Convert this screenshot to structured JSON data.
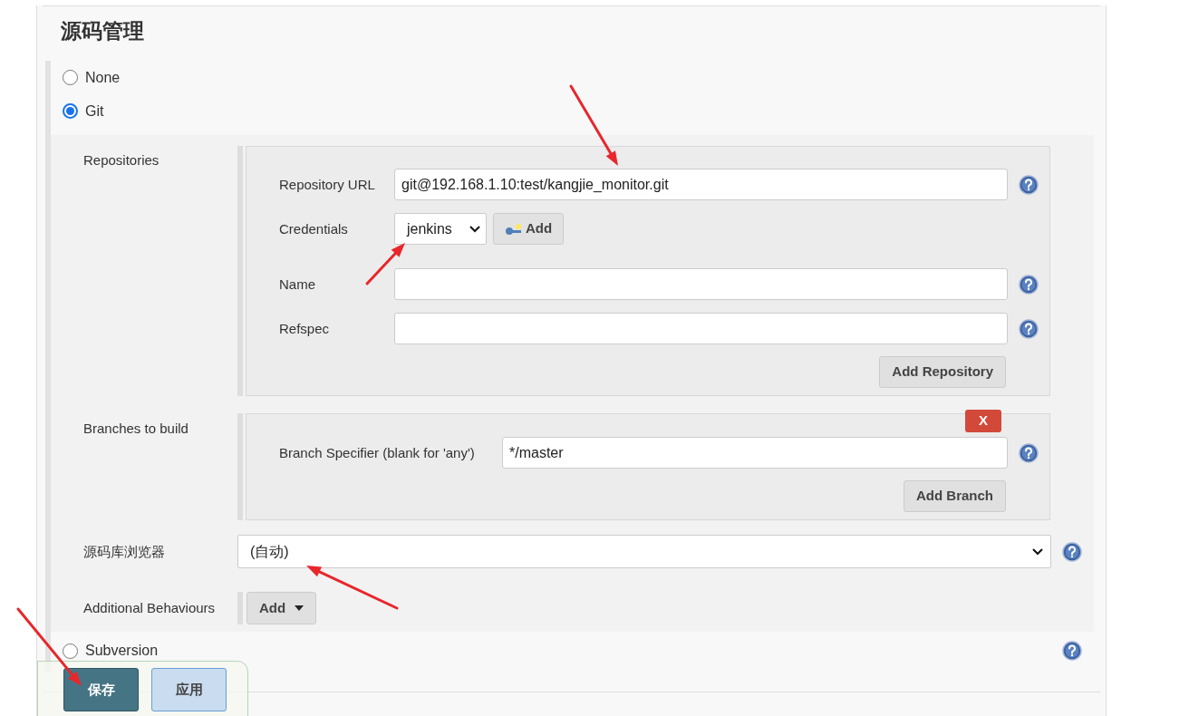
{
  "section": {
    "title": "源码管理"
  },
  "scm_options": [
    {
      "label": "None",
      "selected": false
    },
    {
      "label": "Git",
      "selected": true
    },
    {
      "label": "Subversion",
      "selected": false
    }
  ],
  "git": {
    "repositories_label": "Repositories",
    "repository_url": {
      "label": "Repository URL",
      "value": "git@192.168.1.10:test/kangjie_monitor.git"
    },
    "credentials": {
      "label": "Credentials",
      "value": "jenkins",
      "add_button": "Add"
    },
    "name": {
      "label": "Name"
    },
    "refspec": {
      "label": "Refspec"
    },
    "add_repository_button": "Add Repository",
    "branches_label": "Branches to build",
    "delete_button": "X",
    "branch_specifier": {
      "label": "Branch Specifier (blank for 'any')",
      "value": "*/master"
    },
    "add_branch_button": "Add Branch",
    "browser": {
      "label": "源码库浏览器",
      "value": "(自动)"
    },
    "additional_behaviours": {
      "label": "Additional Behaviours",
      "button": "Add"
    }
  },
  "save_bar": {
    "buttons": [
      {
        "label": "保存",
        "kind": "primary"
      },
      {
        "label": "应用",
        "kind": "secondary"
      }
    ]
  }
}
